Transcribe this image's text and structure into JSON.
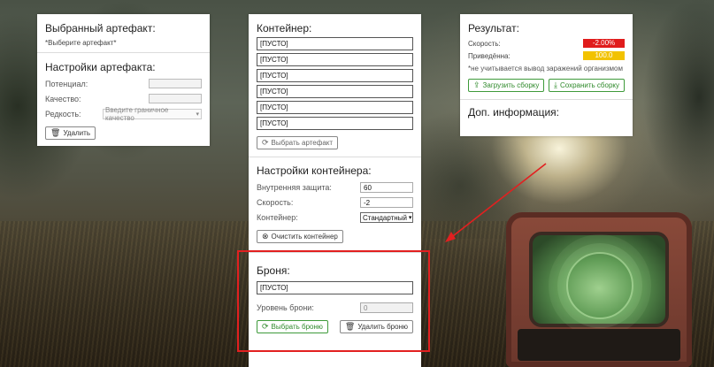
{
  "artifact_panel": {
    "selected_title": "Выбранный артефакт:",
    "selected_hint": "*Выберите артефакт*",
    "settings_title": "Настройки артефакта:",
    "potential_label": "Потенциал:",
    "quality_label": "Качество:",
    "rarity_label": "Редкость:",
    "rarity_placeholder": "Введите граничное качество",
    "delete_label": "Удалить"
  },
  "container_panel": {
    "title": "Контейнер:",
    "slots": [
      "[ПУСТО]",
      "[ПУСТО]",
      "[ПУСТО]",
      "[ПУСТО]",
      "[ПУСТО]",
      "[ПУСТО]"
    ],
    "select_artifact_label": "Выбрать артефакт",
    "settings_title": "Настройки контейнера:",
    "inner_protection_label": "Внутренняя защита:",
    "inner_protection_value": "60",
    "speed_label": "Скорость:",
    "speed_value": "-2",
    "container_label": "Контейнер:",
    "container_value": "Стандартный",
    "clear_label": "Очистить контейнер"
  },
  "armor_section": {
    "title": "Броня:",
    "slot": "[ПУСТО]",
    "level_label": "Уровень брони:",
    "level_value": "0",
    "select_label": "Выбрать броню",
    "delete_label": "Удалить броню"
  },
  "result_panel": {
    "title": "Результат:",
    "speed_label": "Скорость:",
    "speed_value": "-2.00%",
    "reduced_label": "Приведённа:",
    "reduced_value": "100.0",
    "note": "*не учитывается вывод заражений организмом",
    "load_label": "Загрузить сборку",
    "save_label": "Сохранить сборку",
    "extra_title": "Доп. информация:"
  },
  "colors": {
    "accent_green": "#2f8a2b",
    "negative": "#e01c1c",
    "warning": "#f2c200",
    "highlight": "#e22020"
  },
  "icons": {
    "trash": "trash-icon",
    "refresh": "refresh-icon",
    "clear": "clear-circle-icon",
    "upload": "upload-icon",
    "download": "download-icon"
  }
}
